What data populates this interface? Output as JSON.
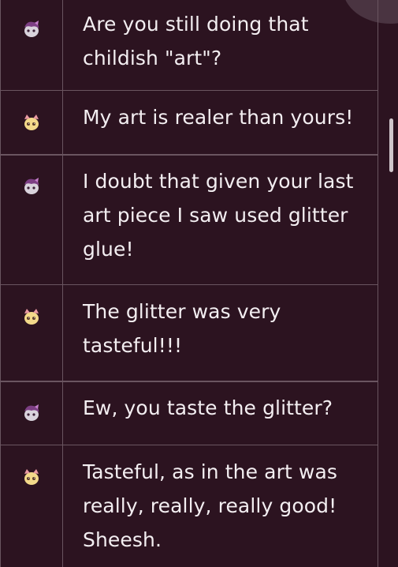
{
  "messages": [
    {
      "speaker": "purple",
      "text": "Are you still doing that\nchildish \"art\"?"
    },
    {
      "speaker": "yellow",
      "text": "My art is realer than yours!"
    },
    {
      "speaker": "purple",
      "text": "I doubt that given your last\nart piece I saw used glitter\nglue!"
    },
    {
      "speaker": "yellow",
      "text": "The glitter was very\ntasteful!!!"
    },
    {
      "speaker": "purple",
      "text": "Ew, you taste the glitter?"
    },
    {
      "speaker": "yellow",
      "text": "Tasteful, as in the art was\nreally, really, really good!\nSheesh."
    }
  ],
  "colors": {
    "background": "#2c1320",
    "grid_line": "#6a5560",
    "text": "#f3eef1",
    "purple_avatar": "#8b4b8f",
    "yellow_avatar": "#f5d47a"
  },
  "icons": {
    "purple": "purple-character-avatar-icon",
    "yellow": "yellow-character-avatar-icon"
  }
}
